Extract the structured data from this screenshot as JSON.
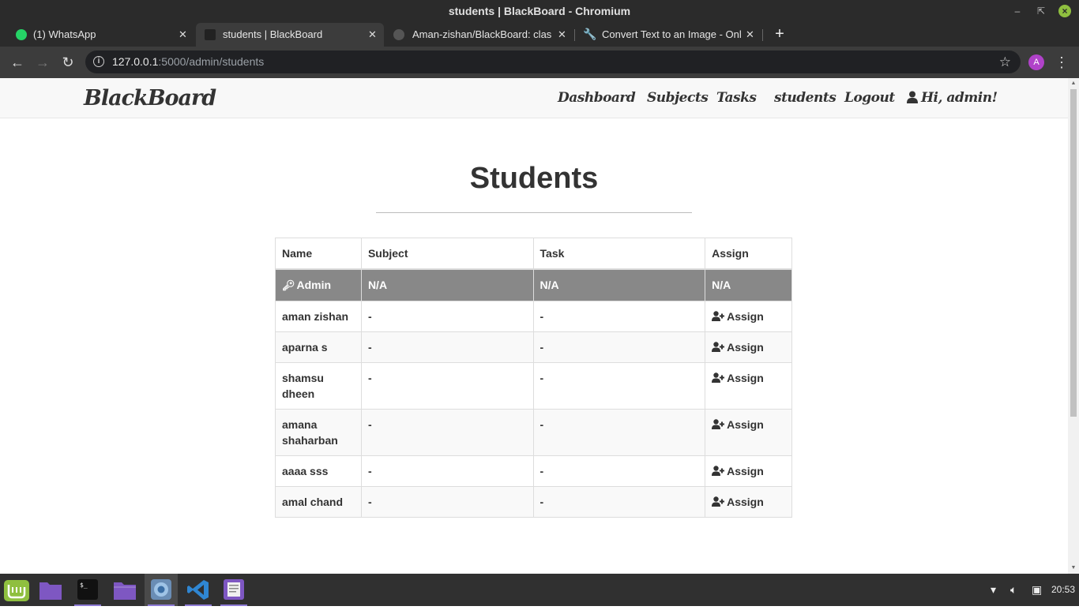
{
  "window": {
    "title": "students | BlackBoard - Chromium"
  },
  "tabs": [
    {
      "title": "(1) WhatsApp",
      "icon": "whatsapp-icon",
      "active": false
    },
    {
      "title": "students | BlackBoard",
      "icon": "blackboard-favicon",
      "active": true
    },
    {
      "title": "Aman-zishan/BlackBoard: class",
      "icon": "github-icon",
      "active": false
    },
    {
      "title": "Convert Text to an Image - Onli",
      "icon": "wrench-icon",
      "active": false
    }
  ],
  "address": {
    "host": "127.0.0.1",
    "path": ":5000/admin/students"
  },
  "profile": {
    "initial": "A",
    "color": "#b042c9"
  },
  "site": {
    "brand": "BlackBoard",
    "nav": [
      "Dashboard",
      "Subjects",
      "Tasks",
      "students",
      "Logout"
    ],
    "greeting": "Hi, admin!"
  },
  "page": {
    "heading": "Students"
  },
  "table": {
    "headers": [
      "Name",
      "Subject",
      "Task",
      "Assign"
    ],
    "admin_row": {
      "name": "Admin",
      "subject": "N/A",
      "task": "N/A",
      "assign": "N/A"
    },
    "rows": [
      {
        "name": "aman zishan",
        "subject": "-",
        "task": "-",
        "assign": "Assign"
      },
      {
        "name": "aparna s",
        "subject": "-",
        "task": "-",
        "assign": "Assign"
      },
      {
        "name": "shamsu dheen",
        "subject": "-",
        "task": "-",
        "assign": "Assign"
      },
      {
        "name": "amana shaharban",
        "subject": "-",
        "task": "-",
        "assign": "Assign"
      },
      {
        "name": "aaaa sss",
        "subject": "-",
        "task": "-",
        "assign": "Assign"
      },
      {
        "name": "amal chand",
        "subject": "-",
        "task": "-",
        "assign": "Assign"
      }
    ]
  },
  "taskbar": {
    "apps": [
      "mint-menu-icon",
      "folder-icon",
      "terminal-icon",
      "files-icon",
      "chromium-icon",
      "vscode-icon",
      "text-editor-icon"
    ],
    "clock": "20:53"
  },
  "colors": {
    "admin_row_bg": "#888888",
    "navbar_bg": "#f8f8f8",
    "chrome_dark": "#2b2b2b"
  }
}
